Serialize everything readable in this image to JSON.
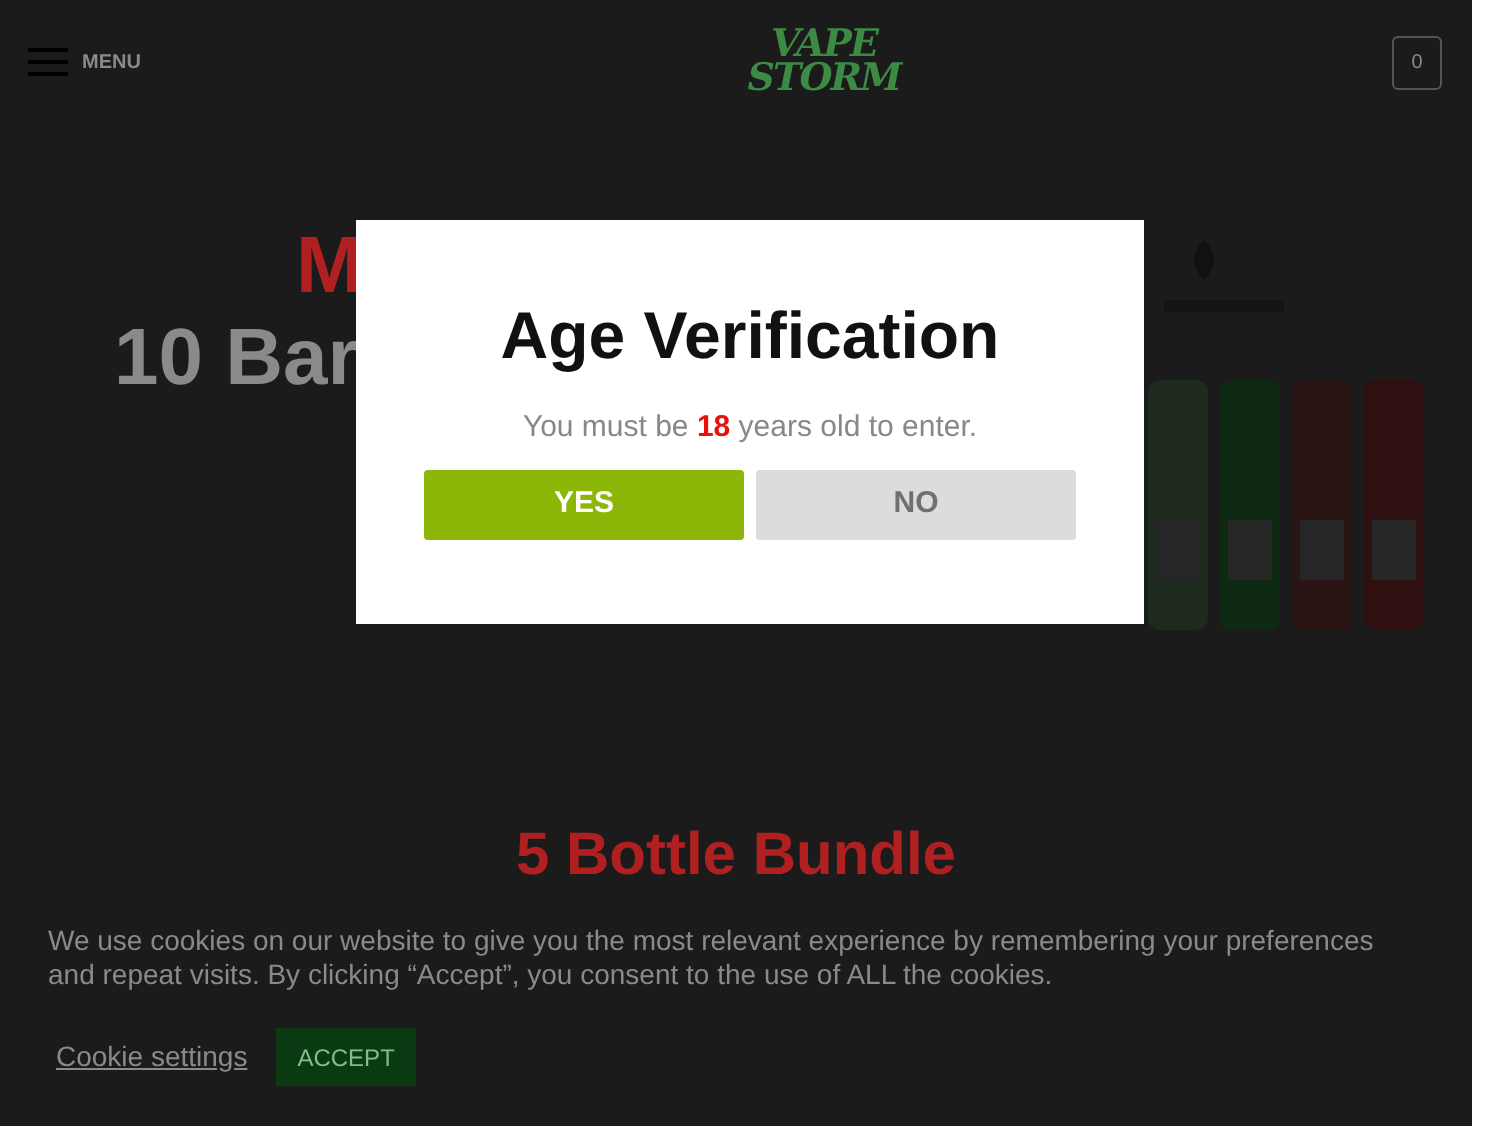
{
  "header": {
    "menu_label": "MENU",
    "logo": [
      "VAPE",
      "STORM"
    ],
    "cart_count": "0"
  },
  "hero": {
    "line_1": "M",
    "line_2": "10 Bar"
  },
  "section_title": "5 Bottle Bundle",
  "modal": {
    "title": "Age Verification",
    "message": "You must be **18** years old to enter.",
    "buttons": [
      {
        "label": "YES",
        "kind": "confirm"
      },
      {
        "label": "NO",
        "kind": "deny"
      }
    ]
  },
  "cookie_bar": {
    "text": "We use cookies on our website to give you the most relevant experience by remembering your preferences and repeat visits. By clicking “Accept”, you consent to the use of ALL the cookies.",
    "settings_link": "Cookie settings",
    "accept_button": "ACCEPT"
  }
}
